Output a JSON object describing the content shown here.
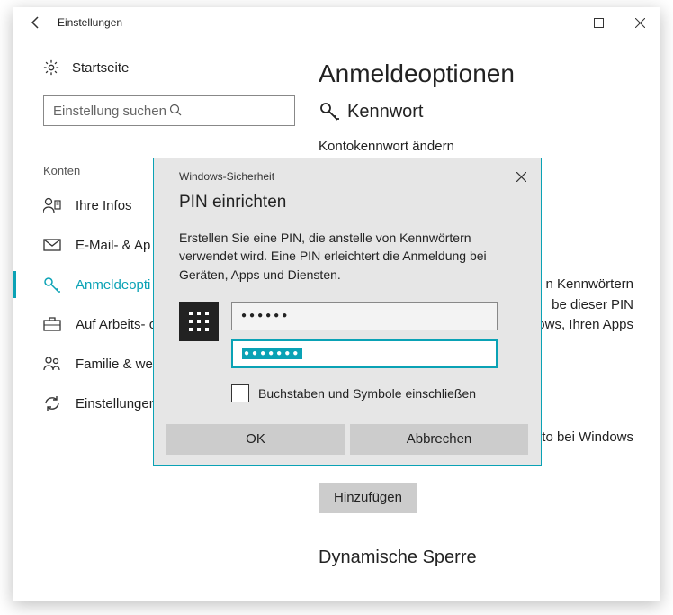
{
  "titlebar": {
    "title": "Einstellungen"
  },
  "sidebar": {
    "home": "Startseite",
    "search_placeholder": "Einstellung suchen",
    "section": "Konten",
    "items": [
      {
        "label": "Ihre Infos"
      },
      {
        "label": "E-Mail- & Ap"
      },
      {
        "label": "Anmeldeopti"
      },
      {
        "label": "Auf Arbeits- o"
      },
      {
        "label": "Familie & wei"
      },
      {
        "label": "Einstellungen"
      }
    ]
  },
  "main": {
    "heading": "Anmeldeoptionen",
    "section_password": "Kennwort",
    "change_pw": "Kontokennwort ändern",
    "bg_lines": [
      "n Kennwörtern",
      "be dieser PIN",
      "ows, Ihren Apps"
    ],
    "hello_tail": "oto bei Windows",
    "add_button": "Hinzufügen",
    "dynamic_lock": "Dynamische Sperre"
  },
  "dialog": {
    "header": "Windows-Sicherheit",
    "title": "PIN einrichten",
    "description": "Erstellen Sie eine PIN, die anstelle von Kennwörtern verwendet wird. Eine PIN erleichtert die Anmeldung bei Geräten, Apps und Diensten.",
    "pin1_mask": "●●●●●●",
    "pin2_mask": "●●●●●●●",
    "checkbox_label": "Buchstaben und Symbole einschließen",
    "ok": "OK",
    "cancel": "Abbrechen"
  }
}
